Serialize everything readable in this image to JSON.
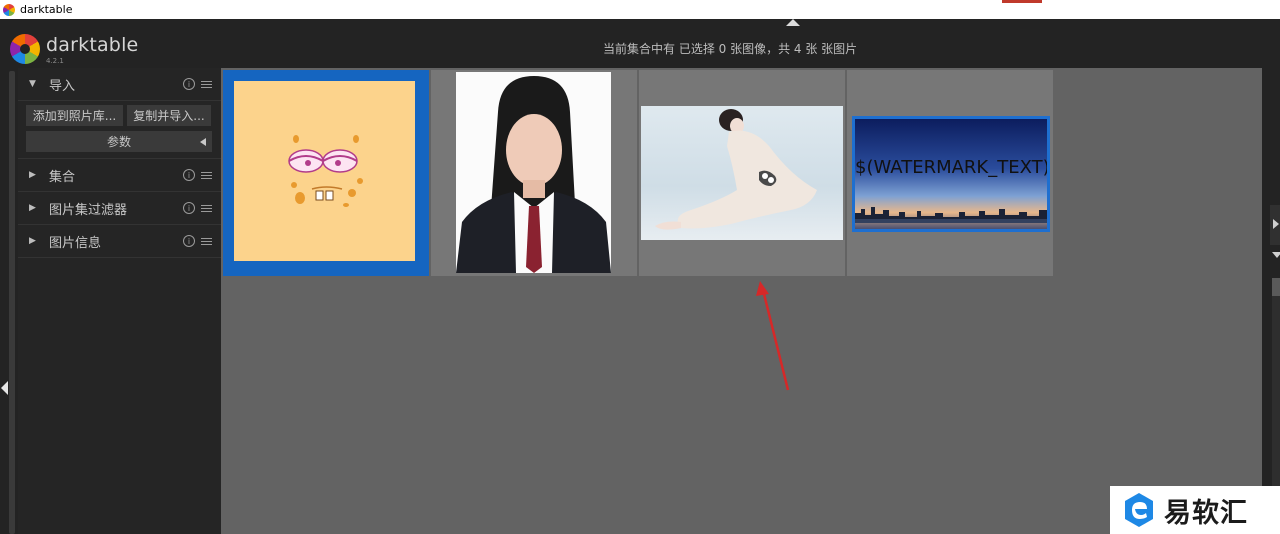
{
  "os_window": {
    "title": "darktable"
  },
  "app": {
    "name": "darktable",
    "version": "4.2.1"
  },
  "header": {
    "status": "当前集合中有 已选择 0 张图像，共 4 张 张图片"
  },
  "left_panel": {
    "import": {
      "title": "导入",
      "expanded": true,
      "add_to_library_label": "添加到照片库...",
      "copy_and_import_label": "复制并导入...",
      "parameters_label": "参数"
    },
    "modules": [
      {
        "title": "集合",
        "expanded": false
      },
      {
        "title": "图片集过滤器",
        "expanded": false
      },
      {
        "title": "图片信息",
        "expanded": false
      }
    ]
  },
  "lighttable": {
    "thumbnails": [
      {
        "subject": "cartoon face",
        "selected": true
      },
      {
        "subject": "portrait in suit",
        "selected": false
      },
      {
        "subject": "woman in white dress",
        "selected": false
      },
      {
        "subject": "city skyline",
        "selected": false,
        "overlay_text": "$(WATERMARK_TEXT)"
      }
    ]
  },
  "watermark_brand": {
    "text": "易软汇",
    "accent": "#1e88e5"
  },
  "colors": {
    "selection": "#1565c0",
    "annotation_arrow": "#d62828"
  }
}
